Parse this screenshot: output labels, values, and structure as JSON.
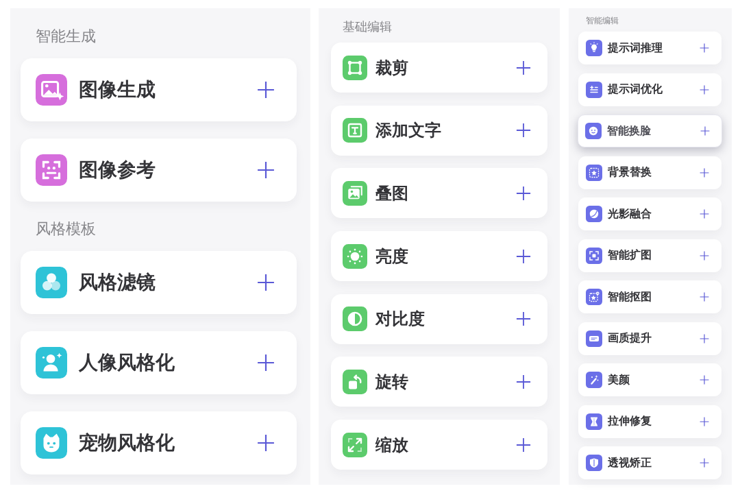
{
  "panels": [
    {
      "kind": "large",
      "sections": [
        {
          "heading": "智能生成",
          "color": "#d66edc",
          "items": [
            {
              "label": "图像生成"
            },
            {
              "label": "图像参考"
            }
          ]
        },
        {
          "heading": "风格模板",
          "color": "#2ec3d7",
          "items": [
            {
              "label": "风格滤镜"
            },
            {
              "label": "人像风格化"
            },
            {
              "label": "宠物风格化"
            }
          ]
        }
      ]
    },
    {
      "kind": "medium",
      "sections": [
        {
          "heading": "基础编辑",
          "color": "#5ccb6c",
          "items": [
            {
              "label": "裁剪"
            },
            {
              "label": "添加文字"
            },
            {
              "label": "叠图"
            },
            {
              "label": "亮度"
            },
            {
              "label": "对比度"
            },
            {
              "label": "旋转"
            },
            {
              "label": "缩放"
            }
          ]
        }
      ]
    },
    {
      "kind": "small",
      "sections": [
        {
          "heading": "智能编辑",
          "color": "#6b6fe8",
          "items": [
            {
              "label": "提示词推理",
              "selected": false
            },
            {
              "label": "提示词优化",
              "selected": false
            },
            {
              "label": "智能换脸",
              "selected": true
            },
            {
              "label": "背景替换",
              "selected": false
            },
            {
              "label": "光影融合",
              "selected": false
            },
            {
              "label": "智能扩图",
              "selected": false
            },
            {
              "label": "智能抠图",
              "selected": false
            },
            {
              "label": "画质提升",
              "selected": false
            },
            {
              "label": "美颜",
              "selected": false
            },
            {
              "label": "拉伸修复",
              "selected": false
            },
            {
              "label": "透视矫正",
              "selected": false
            }
          ]
        }
      ]
    }
  ]
}
